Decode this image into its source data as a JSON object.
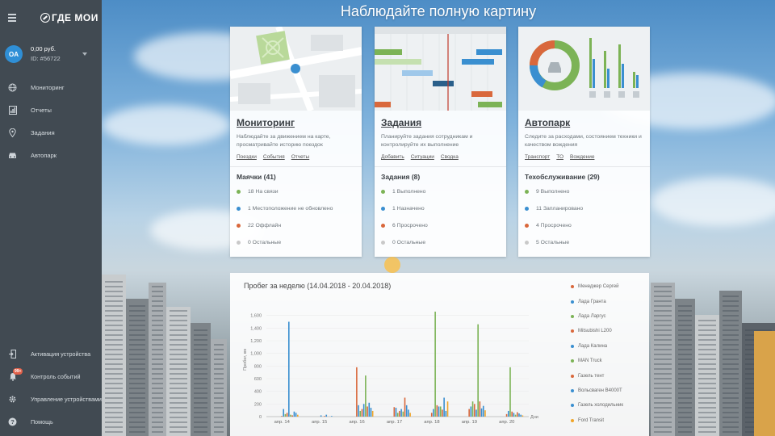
{
  "app": {
    "logo_text": "ГДЕ МОИ"
  },
  "account": {
    "initials": "OA",
    "balance": "0,00 руб.",
    "id": "ID: #56722"
  },
  "nav": [
    {
      "label": "Мониторинг",
      "icon": "globe-icon"
    },
    {
      "label": "Отчеты",
      "icon": "report-icon"
    },
    {
      "label": "Задания",
      "icon": "location-pin-icon"
    },
    {
      "label": "Автопарк",
      "icon": "car-icon"
    }
  ],
  "bottom_nav": [
    {
      "label": "Активация устройства",
      "icon": "activate-device-icon"
    },
    {
      "label": "Контроль событий",
      "icon": "bell-icon",
      "badge": "99+"
    },
    {
      "label": "Управление устройствами",
      "icon": "gear-icon"
    },
    {
      "label": "Помощь",
      "icon": "help-icon"
    }
  ],
  "page_title": "Наблюдайте полную картину",
  "cards": [
    {
      "title": "Мониторинг",
      "desc": "Наблюдайте за движением на карте, просматривайте историю поездок",
      "links": [
        "Поездки",
        "События",
        "Отчеты"
      ],
      "stats_title": "Маячки (41)",
      "stats": [
        {
          "text": "18 На связи",
          "color": "#7cb356"
        },
        {
          "text": "1 Местоположение не обновлено",
          "color": "#3a8fd0"
        },
        {
          "text": "22 Оффлайн",
          "color": "#d9683c"
        },
        {
          "text": "0 Остальные",
          "color": "#c9c9c9"
        }
      ]
    },
    {
      "title": "Задания",
      "desc": "Планируйте задания сотрудникам и контролируйте их выполнение",
      "links": [
        "Добавить",
        "Ситуации",
        "Сводка"
      ],
      "stats_title": "Задания (8)",
      "stats": [
        {
          "text": "1 Выполнено",
          "color": "#7cb356"
        },
        {
          "text": "1 Назначено",
          "color": "#3a8fd0"
        },
        {
          "text": "6 Просрочено",
          "color": "#d9683c"
        },
        {
          "text": "0 Остальные",
          "color": "#c9c9c9"
        }
      ]
    },
    {
      "title": "Автопарк",
      "desc": "Следите за расходами, состоянием техники и качеством вождения",
      "links": [
        "Транспорт",
        "ТО",
        "Вождение"
      ],
      "stats_title": "Техобслуживание (29)",
      "stats": [
        {
          "text": "9 Выполнено",
          "color": "#7cb356"
        },
        {
          "text": "11 Запланировано",
          "color": "#3a8fd0"
        },
        {
          "text": "4 Просрочено",
          "color": "#d9683c"
        },
        {
          "text": "5 Остальные",
          "color": "#c9c9c9"
        }
      ]
    }
  ],
  "chart_data": {
    "type": "bar",
    "title": "Пробег за неделю (14.04.2018 - 20.04.2018)",
    "ylabel": "Пробег, км",
    "xlabel": "Дни",
    "ylim": [
      0,
      1800
    ],
    "yticks": [
      "0",
      "200",
      "400",
      "600",
      "800",
      "1,000",
      "1,200",
      "1,400",
      "1,600"
    ],
    "categories": [
      "апр. 14",
      "апр. 15",
      "апр. 16",
      "апр. 17",
      "апр. 18",
      "апр. 19",
      "апр. 20"
    ],
    "series": [
      {
        "name": "Менеджер Сергей",
        "color": "#d9683c",
        "values": [
          10,
          0,
          780,
          150,
          60,
          120,
          40
        ]
      },
      {
        "name": "Лада Гранта",
        "color": "#3a8fd0",
        "values": [
          120,
          20,
          180,
          140,
          120,
          160,
          90
        ]
      },
      {
        "name": "Лада Ларгус",
        "color": "#7cb356",
        "values": [
          40,
          0,
          90,
          60,
          1660,
          240,
          780
        ]
      },
      {
        "name": "Mitsubishi L200",
        "color": "#d9683c",
        "values": [
          60,
          10,
          120,
          90,
          180,
          200,
          80
        ]
      },
      {
        "name": "Лада Калина",
        "color": "#3a8fd0",
        "values": [
          1500,
          30,
          200,
          120,
          160,
          110,
          60
        ]
      },
      {
        "name": "MAN Truck",
        "color": "#7cb356",
        "values": [
          30,
          0,
          650,
          80,
          160,
          1460,
          30
        ]
      },
      {
        "name": "Газель тент",
        "color": "#d9683c",
        "values": [
          20,
          0,
          160,
          300,
          110,
          240,
          70
        ]
      },
      {
        "name": "Вольсваген В4000Т",
        "color": "#3a8fd0",
        "values": [
          80,
          10,
          220,
          180,
          300,
          130,
          50
        ]
      },
      {
        "name": "Газель холодильник",
        "color": "#3a8fd0",
        "values": [
          60,
          0,
          140,
          110,
          90,
          170,
          30
        ]
      },
      {
        "name": "Ford Transit",
        "color": "#f0a528",
        "values": [
          30,
          0,
          90,
          60,
          240,
          100,
          20
        ]
      }
    ]
  }
}
